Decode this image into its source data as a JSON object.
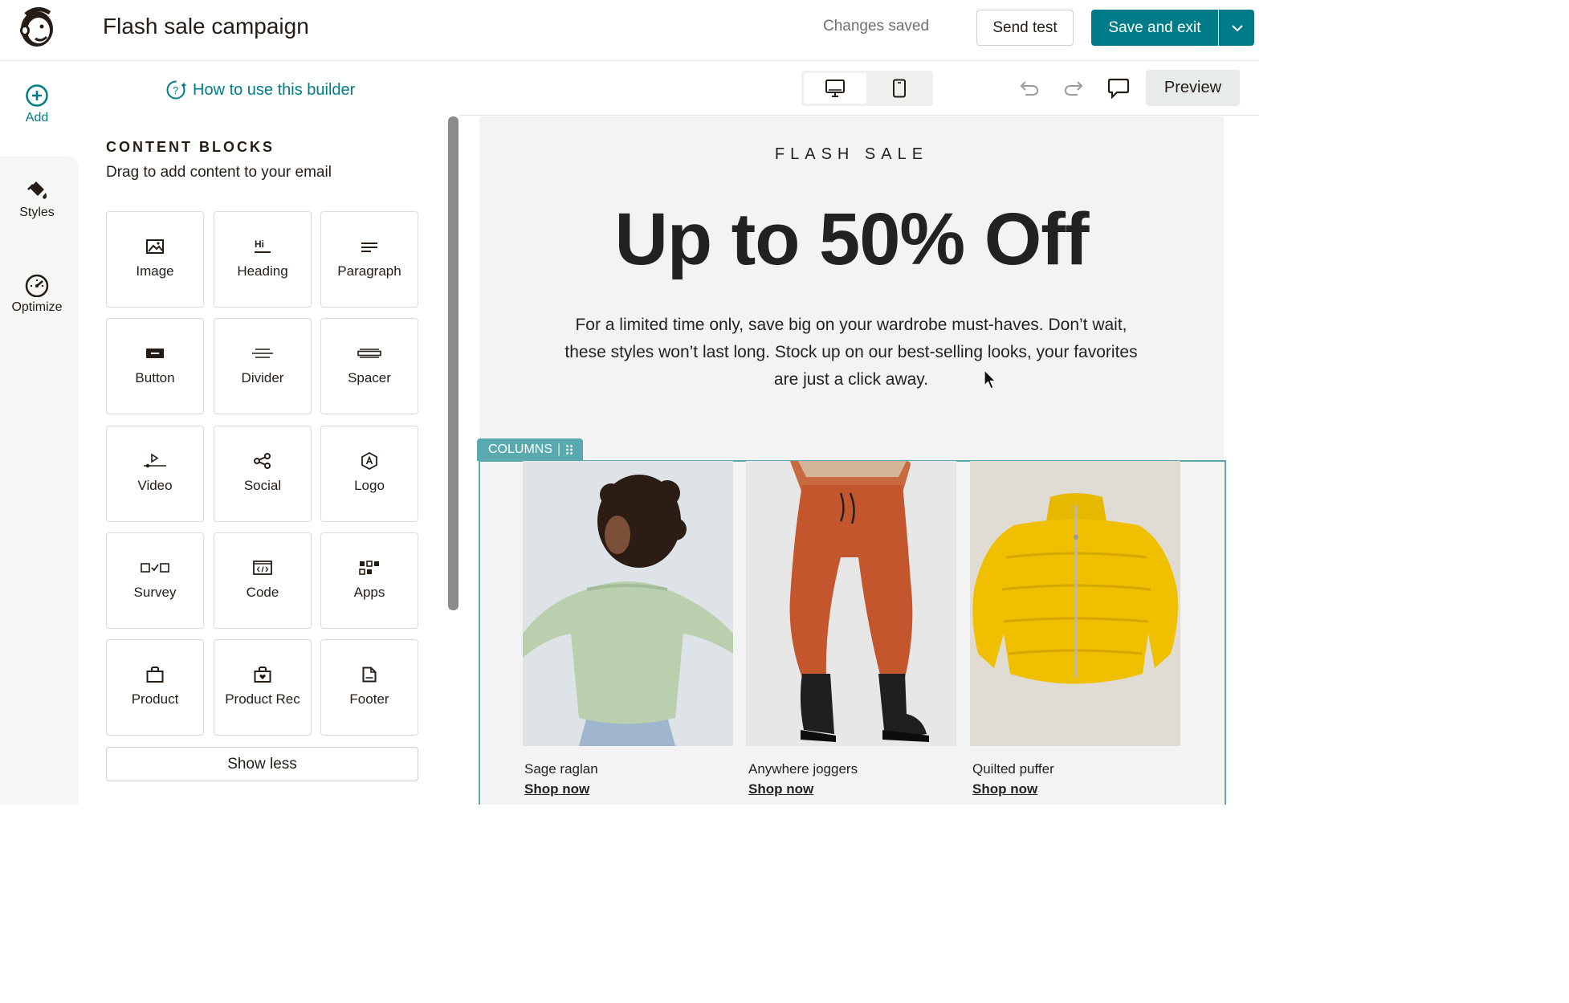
{
  "header": {
    "campaign_title": "Flash sale campaign",
    "status": "Changes saved",
    "send_test_label": "Send test",
    "save_exit_label": "Save and exit",
    "brand_color": "#007c89"
  },
  "rail": {
    "items": [
      {
        "label": "Add",
        "icon": "add-circle-icon"
      },
      {
        "label": "Styles",
        "icon": "paint-bucket-icon"
      },
      {
        "label": "Optimize",
        "icon": "gauge-icon"
      }
    ]
  },
  "panel": {
    "how_to_label": "How to use this builder",
    "title": "CONTENT BLOCKS",
    "subtitle": "Drag to add content to your email",
    "blocks": [
      {
        "label": "Image",
        "icon": "image-icon"
      },
      {
        "label": "Heading",
        "icon": "heading-icon"
      },
      {
        "label": "Paragraph",
        "icon": "paragraph-icon"
      },
      {
        "label": "Button",
        "icon": "button-icon"
      },
      {
        "label": "Divider",
        "icon": "divider-icon"
      },
      {
        "label": "Spacer",
        "icon": "spacer-icon"
      },
      {
        "label": "Video",
        "icon": "video-icon"
      },
      {
        "label": "Social",
        "icon": "share-icon"
      },
      {
        "label": "Logo",
        "icon": "logo-icon"
      },
      {
        "label": "Survey",
        "icon": "survey-icon"
      },
      {
        "label": "Code",
        "icon": "code-icon"
      },
      {
        "label": "Apps",
        "icon": "apps-icon"
      },
      {
        "label": "Product",
        "icon": "shopping-bag-icon"
      },
      {
        "label": "Product Rec",
        "icon": "product-rec-icon"
      },
      {
        "label": "Footer",
        "icon": "document-icon"
      }
    ],
    "show_less_label": "Show less",
    "heading_icon_text": "Hi"
  },
  "toolbar": {
    "preview_label": "Preview"
  },
  "email": {
    "eyebrow": "FLASH SALE",
    "headline": "Up to 50% Off",
    "body": "For a limited time only, save big on your wardrobe must-haves. Don’t wait, these styles won’t last long. Stock up on our best-selling looks, your favorites are just a click away.",
    "columns_tag": "COLUMNS",
    "products": [
      {
        "name": "Sage raglan",
        "link": "Shop now"
      },
      {
        "name": "Anywhere joggers",
        "link": "Shop now"
      },
      {
        "name": "Quilted puffer",
        "link": "Shop now"
      }
    ]
  }
}
